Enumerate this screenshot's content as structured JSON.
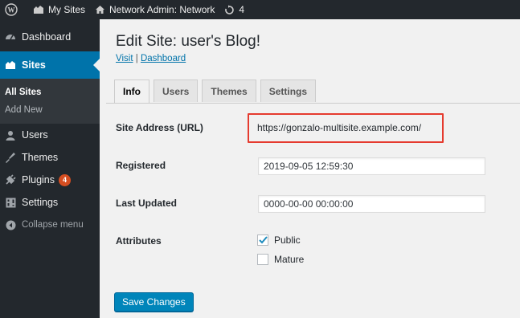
{
  "adminbar": {
    "my_sites": "My Sites",
    "network_admin": "Network Admin: Network",
    "updates_count": "4"
  },
  "sidebar": {
    "items": [
      {
        "label": "Dashboard",
        "icon": "dashboard-icon"
      },
      {
        "label": "Sites",
        "icon": "sites-icon"
      },
      {
        "label": "Users",
        "icon": "users-icon"
      },
      {
        "label": "Themes",
        "icon": "themes-icon"
      },
      {
        "label": "Plugins",
        "icon": "plugins-icon",
        "badge": "4"
      },
      {
        "label": "Settings",
        "icon": "settings-icon"
      }
    ],
    "submenu": [
      "All Sites",
      "Add New"
    ],
    "collapse": "Collapse menu"
  },
  "page": {
    "title": "Edit Site: user's Blog!",
    "visit_link": "Visit",
    "separator": "|",
    "dashboard_link": "Dashboard"
  },
  "tabs": [
    "Info",
    "Users",
    "Themes",
    "Settings"
  ],
  "form": {
    "site_address_label": "Site Address (URL)",
    "site_address_value": "https://gonzalo-multisite.example.com/",
    "registered_label": "Registered",
    "registered_value": "2019-09-05 12:59:30",
    "last_updated_label": "Last Updated",
    "last_updated_value": "0000-00-00 00:00:00",
    "attributes_label": "Attributes",
    "public_label": "Public",
    "public_checked": true,
    "mature_label": "Mature",
    "mature_checked": false,
    "save_button": "Save Changes"
  },
  "colors": {
    "adminbar_bg": "#23282d",
    "accent": "#0073aa",
    "highlight_border": "#e53b2f",
    "badge": "#d54e21"
  }
}
